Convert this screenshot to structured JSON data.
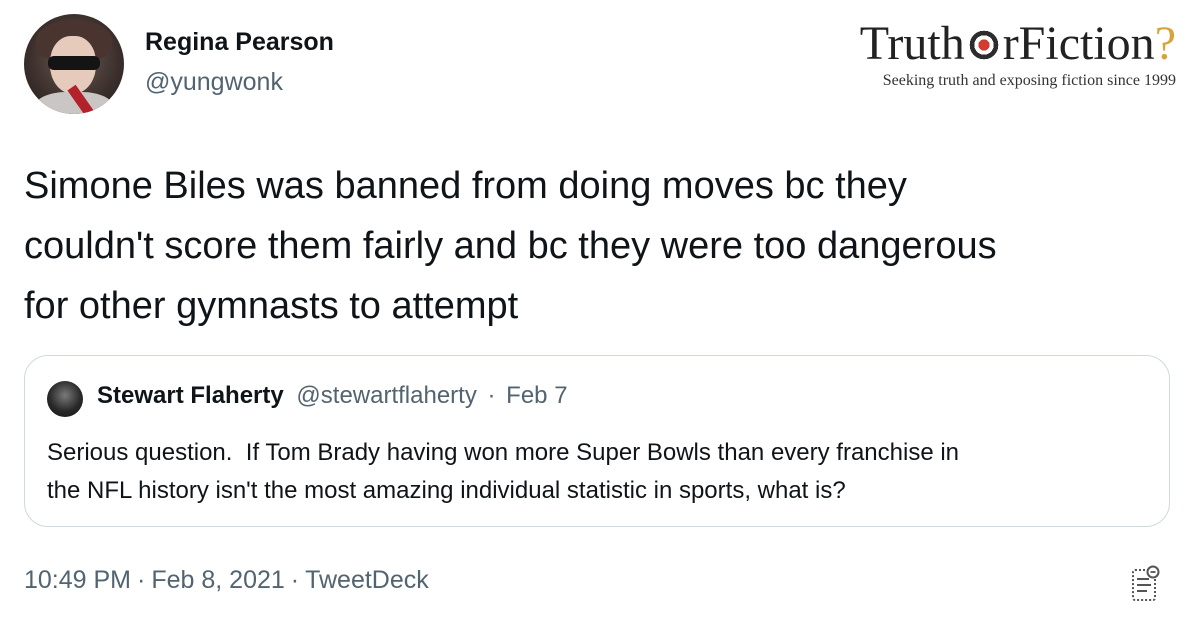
{
  "author": {
    "name": "Regina Pearson",
    "handle": "@yungwonk"
  },
  "brand": {
    "title_left": "Truth",
    "title_right": "rFiction",
    "title_q": "?",
    "tagline": "Seeking truth and exposing fiction since 1999"
  },
  "tweet": {
    "lines": [
      "Simone Biles was banned from doing moves bc they",
      "couldn't score them fairly and bc they were too dangerous",
      "for other gymnasts to attempt"
    ]
  },
  "quote": {
    "name": "Stewart Flaherty",
    "handle": "@stewartflaherty",
    "separator": "·",
    "date": "Feb 7",
    "lines": [
      "Serious question.  If Tom Brady having won more Super Bowls than every franchise in",
      "the NFL history isn't the most amazing individual statistic in sports, what is?"
    ]
  },
  "meta": {
    "time": "10:49 PM",
    "separator": "·",
    "date": "Feb 8, 2021",
    "source": "TweetDeck"
  },
  "icons": {
    "avatar": "profile-photo",
    "quote_avatar": "profile-photo",
    "corner": "analytics-icon"
  },
  "colors": {
    "text": "#0f1419",
    "secondary": "#536471",
    "border": "#cfd9de",
    "brand_accent": "#d8a43a",
    "target_red": "#d63b2f"
  }
}
